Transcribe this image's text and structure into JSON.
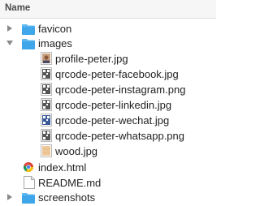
{
  "header": {
    "name_label": "Name"
  },
  "rows": [
    {
      "label": "favicon"
    },
    {
      "label": "images"
    },
    {
      "label": "profile-peter.jpg"
    },
    {
      "label": "qrcode-peter-facebook.jpg"
    },
    {
      "label": "qrcode-peter-instagram.png"
    },
    {
      "label": "qrcode-peter-linkedin.jpg"
    },
    {
      "label": "qrcode-peter-wechat.jpg"
    },
    {
      "label": "qrcode-peter-whatsapp.png"
    },
    {
      "label": "wood.jpg"
    },
    {
      "label": "index.html"
    },
    {
      "label": "README.md"
    },
    {
      "label": "screenshots"
    }
  ]
}
